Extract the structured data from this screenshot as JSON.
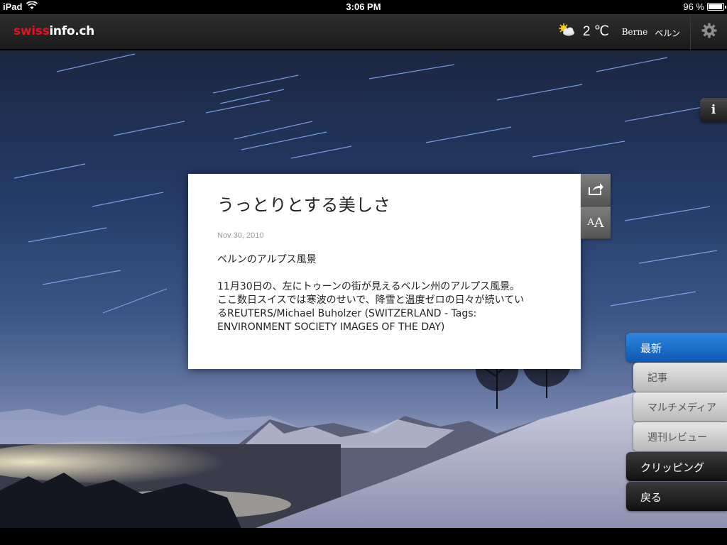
{
  "status": {
    "device": "iPad",
    "time": "3:06 PM",
    "battery": "96 %",
    "battery_level": 0.96
  },
  "header": {
    "logo_red": "swiss",
    "logo_white": "info.ch",
    "temperature": "2 ℃",
    "city_latin": "Berne",
    "city_japanese": "ベルン"
  },
  "info_label": "i",
  "article": {
    "title": "うっとりとする美しさ",
    "date": "Nov 30, 2010",
    "subtitle": "ベルンのアルプス風景",
    "body": "11月30日の、左にトゥーンの街が見えるベルン州のアルプス風景。ここ数日スイスでは寒波のせいで、降雪と温度ゼロの日々が続いているREUTERS/Michael Buholzer (SWITZERLAND - Tags: ENVIRONMENT SOCIETY IMAGES OF THE DAY)",
    "font_small": "A",
    "font_big": "A"
  },
  "nav": {
    "items": [
      {
        "label": "最新"
      },
      {
        "label": "記事"
      },
      {
        "label": "マルチメディア"
      },
      {
        "label": "週刊レビュー"
      },
      {
        "label": "クリッピング"
      },
      {
        "label": "戻る"
      }
    ]
  },
  "colors": {
    "brand_red": "#e0161e",
    "active_blue": "#1b6fcb"
  },
  "icons": {
    "weather": "partly-sunny-icon",
    "settings": "gear-icon",
    "share": "share-icon",
    "wifi": "wifi-icon"
  }
}
